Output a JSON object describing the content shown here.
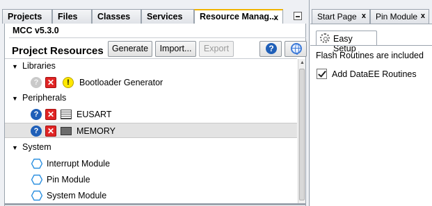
{
  "left_panel": {
    "tabs": [
      "Projects",
      "Files",
      "Classes",
      "Services",
      "Resource Manag..."
    ],
    "active_tab": "Resource Manag...",
    "mcc_version": "MCC v5.3.0",
    "project_resources_title": "Project Resources",
    "buttons": {
      "generate": "Generate",
      "import": "Import...",
      "export": "Export"
    },
    "tree": {
      "libraries": {
        "label": "Libraries",
        "items": [
          {
            "label": "Bootloader Generator"
          }
        ]
      },
      "peripherals": {
        "label": "Peripherals",
        "items": [
          {
            "label": "EUSART"
          },
          {
            "label": "MEMORY"
          }
        ]
      },
      "system": {
        "label": "System",
        "items": [
          {
            "label": "Interrupt Module"
          },
          {
            "label": "Pin Module"
          },
          {
            "label": "System Module"
          }
        ]
      }
    },
    "selected_item": "MEMORY"
  },
  "right_panel": {
    "tabs": [
      "Start Page",
      "Pin Module"
    ],
    "easy_setup_tab": "Easy Setup",
    "flash_text": "Flash Routines are included",
    "checkbox": {
      "label": "Add DataEE Routines",
      "checked": true
    }
  },
  "glyphs": {
    "help": "?",
    "close": "x",
    "error": "✕",
    "warning": "!",
    "collapse": "▼"
  },
  "colors": {
    "accent_tab": "#f0b400",
    "error": "#e02424",
    "help": "#1f5fb8",
    "warning": "#ffe800",
    "hex_icon": "#2a8fe0"
  }
}
